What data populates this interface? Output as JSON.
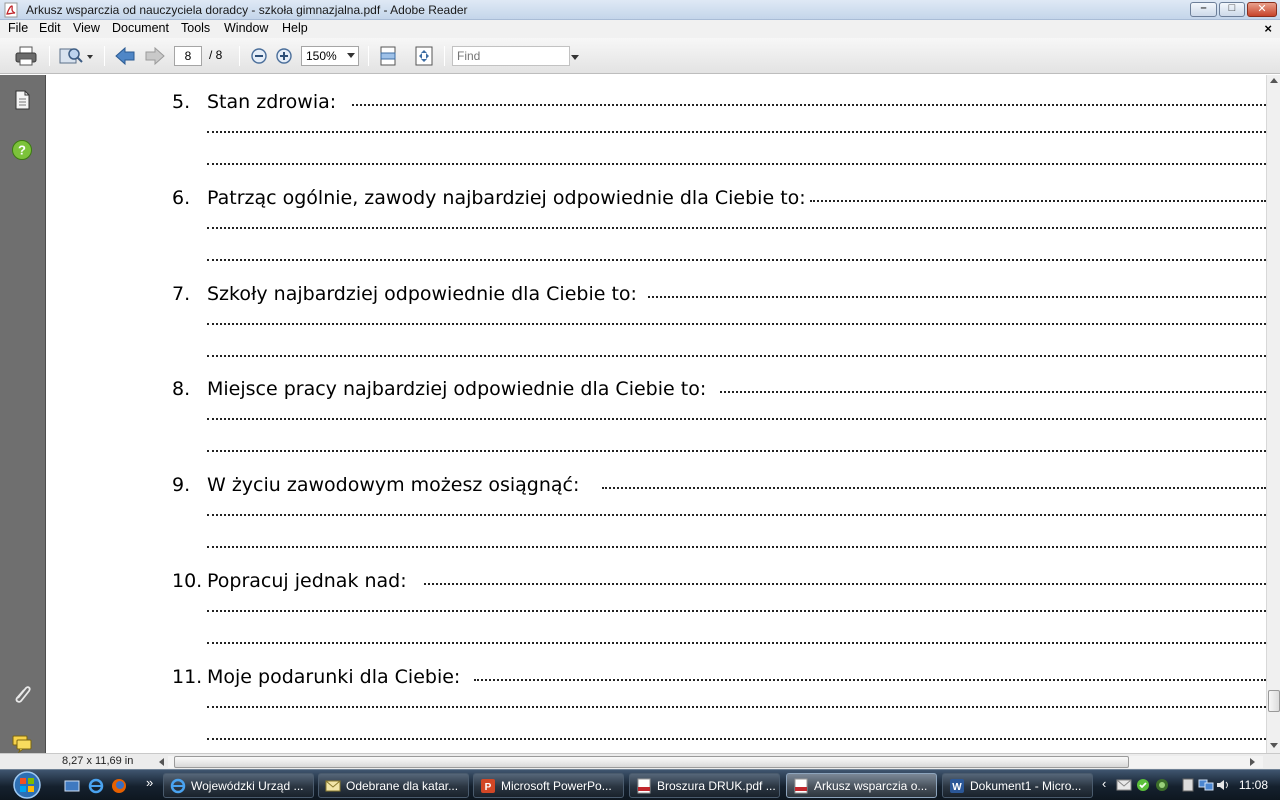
{
  "window": {
    "title": "Arkusz wsparczia od nauczyciela doradcy - szkoła gimnazjalna.pdf - Adobe Reader",
    "controls": {
      "minimize": "–",
      "maximize": "□",
      "close": "✕"
    }
  },
  "menu": {
    "items": [
      "File",
      "Edit",
      "View",
      "Document",
      "Tools",
      "Window",
      "Help"
    ],
    "close_document": "×"
  },
  "toolbar": {
    "page_current": "8",
    "page_total": "/ 8",
    "zoom": "150%",
    "find_placeholder": "Find"
  },
  "document": {
    "items": [
      {
        "number": "5.",
        "text": "Stan   zdrowia:"
      },
      {
        "number": "6.",
        "text": "Patrząc ogólnie, zawody najbardziej odpowiednie dla Ciebie to:"
      },
      {
        "number": "7.",
        "text": "Szkoły najbardziej odpowiednie dla Ciebie to:"
      },
      {
        "number": "8.",
        "text": "Miejsce pracy najbardziej odpowiednie dla Ciebie to:"
      },
      {
        "number": "9.",
        "text": "W  życiu  zawodowym  możesz  osiągnąć: "
      },
      {
        "number": "10.",
        "text": "Popracuj  jednak  nad:"
      },
      {
        "number": "11.",
        "text": "Moje podarunki dla Ciebie:"
      }
    ]
  },
  "statusbar": {
    "page_size": "8,27 x 11,69 in"
  },
  "taskbar": {
    "tasks": [
      {
        "label": "Wojewódzki Urząd ...",
        "icon": "ie-icon"
      },
      {
        "label": "Odebrane dla katar...",
        "icon": "mail-icon"
      },
      {
        "label": "Microsoft PowerPo...",
        "icon": "powerpoint-icon"
      },
      {
        "label": "Broszura DRUK.pdf ...",
        "icon": "pdf-icon"
      },
      {
        "label": "Arkusz wsparczia o...",
        "icon": "pdf-icon"
      },
      {
        "label": "Dokument1 - Micro...",
        "icon": "word-icon"
      }
    ],
    "clock": "11:08",
    "quicklaunch_more": "»",
    "tray_expand": "‹"
  },
  "colors": {
    "nav_panel": "#6f6f6f",
    "taskbar": "#15212e",
    "help_icon": "#7cc23a",
    "pdf_red": "#c1272d"
  }
}
